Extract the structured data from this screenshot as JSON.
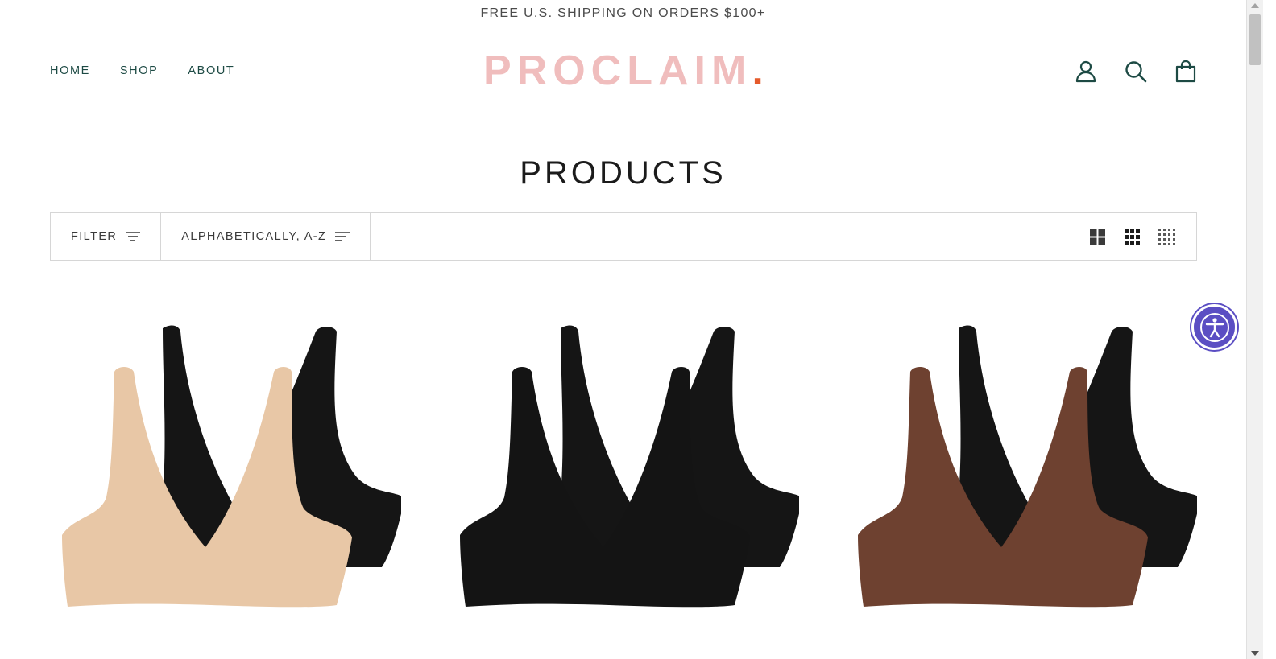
{
  "announcement": {
    "text": "FREE U.S. SHIPPING ON ORDERS $100+"
  },
  "header": {
    "nav": [
      {
        "label": "HOME"
      },
      {
        "label": "SHOP"
      },
      {
        "label": "ABOUT"
      }
    ],
    "logo": {
      "text": "PROCLAIM",
      "dot": ".",
      "text_color": "#f0bdbd",
      "dot_color": "#e55a2b"
    },
    "icons": [
      "account-icon",
      "search-icon",
      "cart-icon"
    ],
    "icon_color": "#1d4a44"
  },
  "main": {
    "title": "PRODUCTS",
    "toolbar": {
      "filter_label": "FILTER",
      "sort_label": "ALPHABETICALLY, A-Z",
      "grid_options": [
        "grid-2-icon",
        "grid-3-icon",
        "grid-4-icon"
      ]
    },
    "products": [
      {
        "front_color": "#e8c7a6",
        "back_color": "#151515"
      },
      {
        "front_color": "#141414",
        "back_color": "#151515"
      },
      {
        "front_color": "#6e4130",
        "back_color": "#151515"
      }
    ]
  },
  "accessibility": {
    "icon": "accessibility-icon",
    "color": "#5b4ec3"
  }
}
